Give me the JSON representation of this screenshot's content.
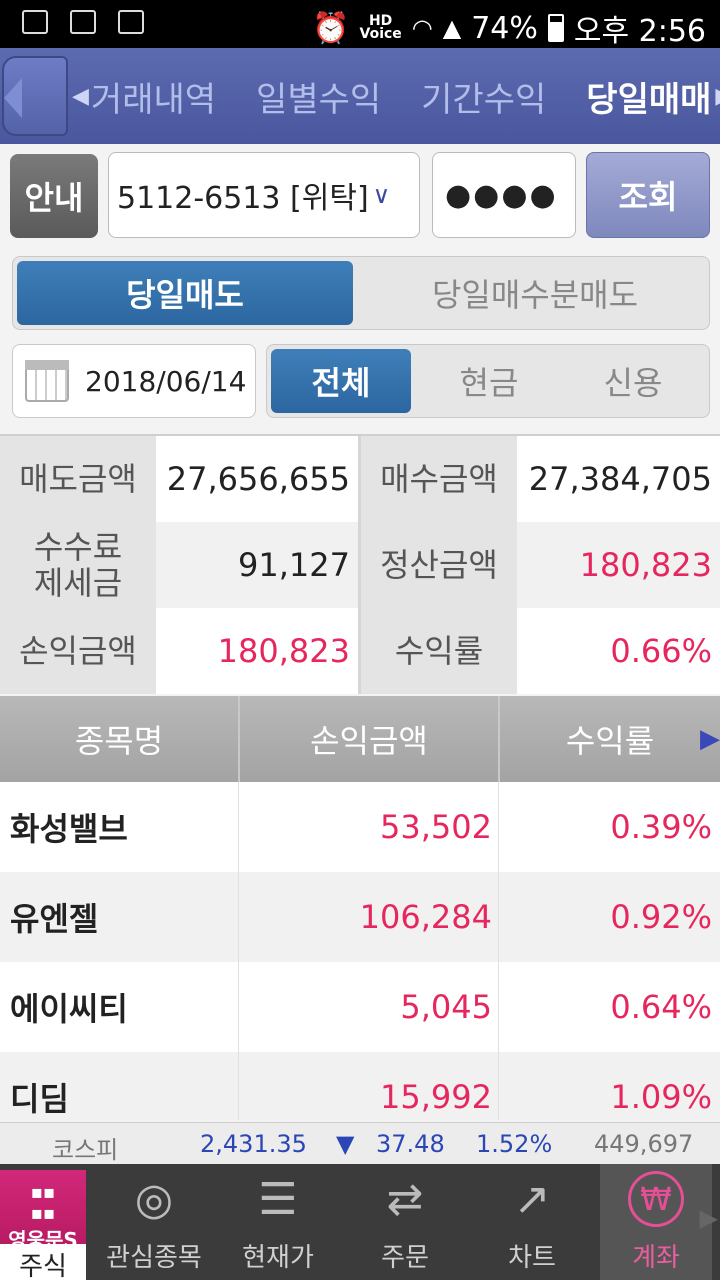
{
  "status_bar": {
    "hd_label": "HD",
    "voice_label": "Voice",
    "battery": "74%",
    "time": "오후 2:56"
  },
  "top_tabs": [
    "거래내역",
    "일별수익",
    "기간수익",
    "당일매매"
  ],
  "account": {
    "info_button": "안내",
    "account_number": "5112-6513 [위탁]",
    "password_mask": "●●●●",
    "query_button": "조회"
  },
  "segment_main": {
    "active": "당일매도",
    "inactive": "당일매수분매도"
  },
  "date": "2018/06/14",
  "segment_filter": {
    "all": "전체",
    "cash": "현금",
    "credit": "신용"
  },
  "summary": {
    "sell_amount_label": "매도금액",
    "sell_amount": "27,656,655",
    "buy_amount_label": "매수금액",
    "buy_amount": "27,384,705",
    "fee_tax_label_1": "수수료",
    "fee_tax_label_2": "제세금",
    "fee_tax": "91,127",
    "settle_label": "정산금액",
    "settle_amount": "180,823",
    "pl_label": "손익금액",
    "pl_amount": "180,823",
    "return_label": "수익률",
    "return_rate": "0.66%"
  },
  "table": {
    "headers": [
      "종목명",
      "손익금액",
      "수익률"
    ],
    "rows": [
      {
        "name": "화성밸브",
        "pl": "53,502",
        "rate": "0.39%"
      },
      {
        "name": "유엔젤",
        "pl": "106,284",
        "rate": "0.92%"
      },
      {
        "name": "에이씨티",
        "pl": "5,045",
        "rate": "0.64%"
      },
      {
        "name": "디딤",
        "pl": "15,992",
        "rate": "1.09%"
      }
    ]
  },
  "ticker": {
    "name": "코스피",
    "value": "2,431.35",
    "arrow": "▼",
    "change": "37.48",
    "pct": "1.52%",
    "volume": "449,697"
  },
  "bottom_nav": {
    "brand": "영웅문S",
    "stock": "주식",
    "watch": "관심종목",
    "price": "현재가",
    "order": "주문",
    "chart": "차트",
    "account": "계좌"
  },
  "colors": {
    "accent_red": "#e6275e",
    "accent_blue": "#2c66a0",
    "nav_blue": "#4a579e",
    "active_pink": "#e44f95"
  }
}
